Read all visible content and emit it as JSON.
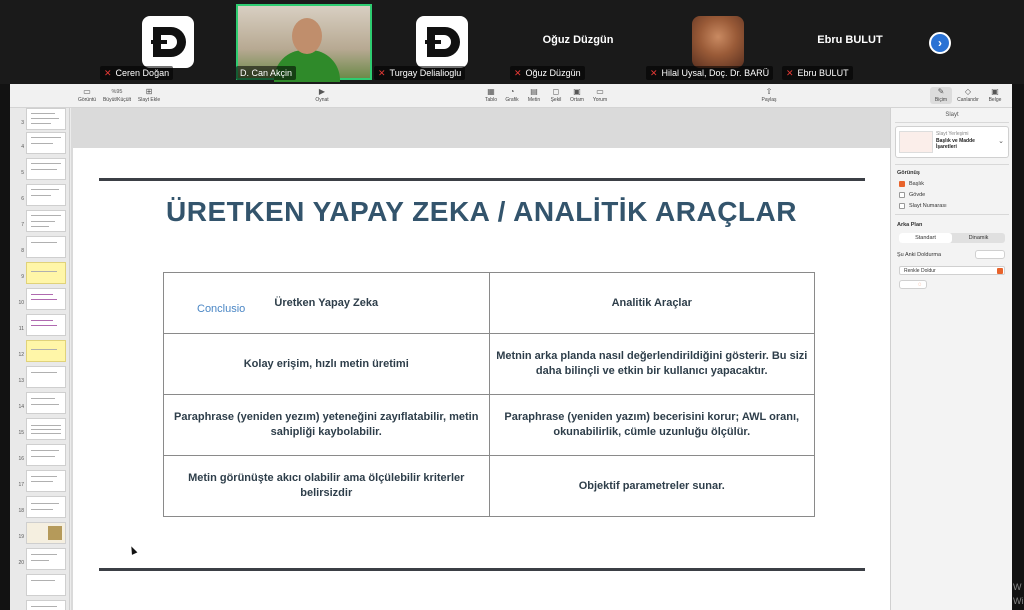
{
  "participants": [
    {
      "name": "Ceren Doğan",
      "kind": "logo",
      "muted": true
    },
    {
      "name": "D. Can Akçin",
      "kind": "video",
      "muted": false,
      "active_speaker": true
    },
    {
      "name": "Turgay Delialioglu",
      "kind": "logo",
      "muted": true
    },
    {
      "name": "Oğuz Düzgün",
      "kind": "name",
      "center_label": "Oğuz Düzgün",
      "muted": true
    },
    {
      "name": "Hilal Uysal, Doç. Dr. BARÜ",
      "kind": "photo",
      "muted": true
    },
    {
      "name": "Ebru BULUT",
      "kind": "name",
      "center_label": "Ebru BULUT",
      "muted": true
    }
  ],
  "zoom": {
    "next_icon": "chevron-right-icon",
    "accent_color": "#2a72d4",
    "active_border": "#2ecc71"
  },
  "toolbar": {
    "view": "Görüntü",
    "zoom_value": "%95",
    "zoom_label": "Büyüt/Küçült",
    "add_slide": "Slayt Ekle",
    "play": "Oynat",
    "table": "Tablo",
    "chart": "Grafik",
    "text": "Metin",
    "shape": "Şekil",
    "media": "Ortam",
    "comment": "Yorum",
    "share": "Paylaş",
    "format": "Biçim",
    "animate": "Canlandır",
    "document": "Belge"
  },
  "navigator": {
    "numbers": [
      "3",
      "4",
      "5",
      "6",
      "7",
      "8",
      "9",
      "10",
      "11",
      "12",
      "13",
      "14",
      "15",
      "16",
      "17",
      "18",
      "19",
      "20"
    ]
  },
  "slide": {
    "title": "ÜRETKEN YAPAY ZEKA / ANALİTİK ARAÇLAR",
    "overlay_label": "Conclusio",
    "table": {
      "headers": [
        "Üretken Yapay Zeka",
        "Analitik Araçlar"
      ],
      "rows": [
        [
          "Kolay erişim, hızlı metin üretimi",
          "Metnin arka planda nasıl değerlendirildiğini gösterir. Bu sizi daha bilinçli ve etkin bir kullanıcı yapacaktır."
        ],
        [
          "Paraphrase (yeniden yezım) yeteneğini zayıflatabilir, metin sahipliği kaybolabilir.",
          "Paraphrase (yeniden yazım) becerisini korur; AWL oranı, okunabilirlik, cümle uzunluğu ölçülür."
        ],
        [
          "Metin görünüşte akıcı olabilir ama ölçülebilir kriterler belirsizdir",
          "Objektif parametreler sunar."
        ]
      ]
    },
    "title_color": "#33546c"
  },
  "right_panel": {
    "title": "Slayt",
    "layout_sub": "Slayt Yerleşimi",
    "layout_name": "Başlık ve Madde İşaretleri",
    "appearance_label": "Görünüş",
    "check_title": "Başlık",
    "check_body": "Gövde",
    "check_slide_number": "Slayt Numarası",
    "background_label": "Arka Plan",
    "seg_standard": "Standart",
    "seg_dynamic": "Dinamik",
    "fill_label": "Şu Anki Doldurma",
    "fill_select": "Renkle Doldur"
  },
  "watermark": "W\nWi"
}
